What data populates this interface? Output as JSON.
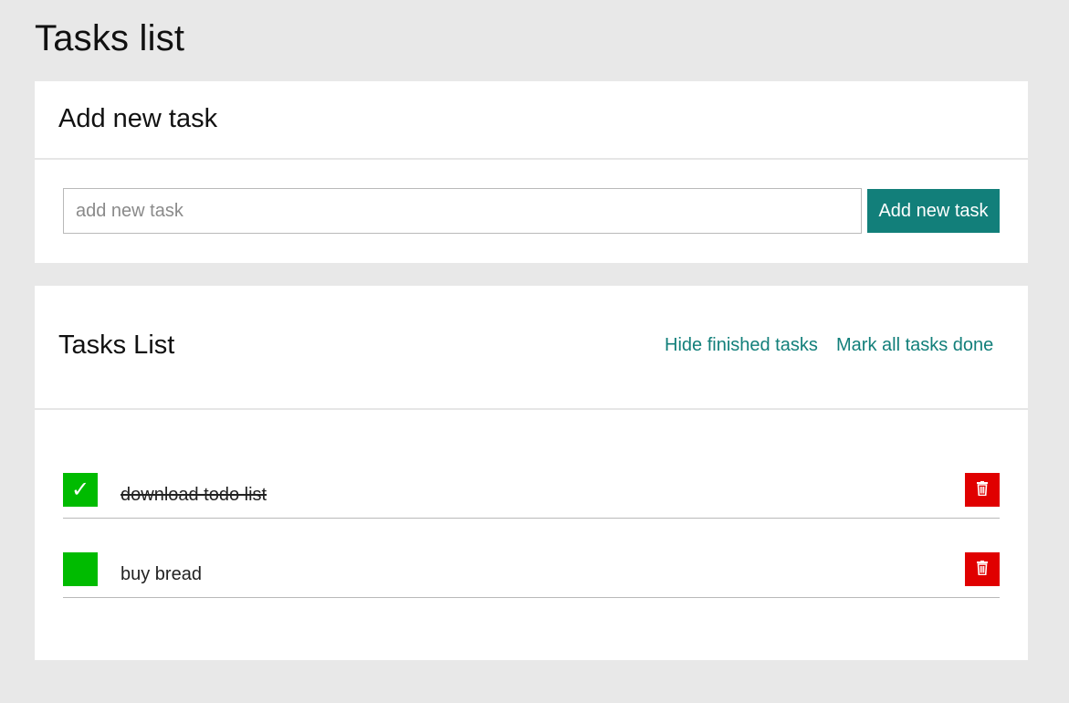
{
  "page": {
    "title": "Tasks list"
  },
  "add_section": {
    "title": "Add new task",
    "input_placeholder": "add new task",
    "input_value": "",
    "button_label": "Add new task"
  },
  "list_section": {
    "title": "Tasks List",
    "hide_finished_label": "Hide finished tasks",
    "mark_all_done_label": "Mark all tasks done",
    "tasks": [
      {
        "label": "download todo list",
        "done": true,
        "check_icon": "✓",
        "delete_icon": "trash-icon"
      },
      {
        "label": "buy bread",
        "done": false,
        "check_icon": "",
        "delete_icon": "trash-icon"
      }
    ]
  },
  "colors": {
    "background": "#e8e8e8",
    "card": "#ffffff",
    "accent": "#127f7a",
    "checkbox": "#00bb00",
    "delete": "#e00000"
  }
}
